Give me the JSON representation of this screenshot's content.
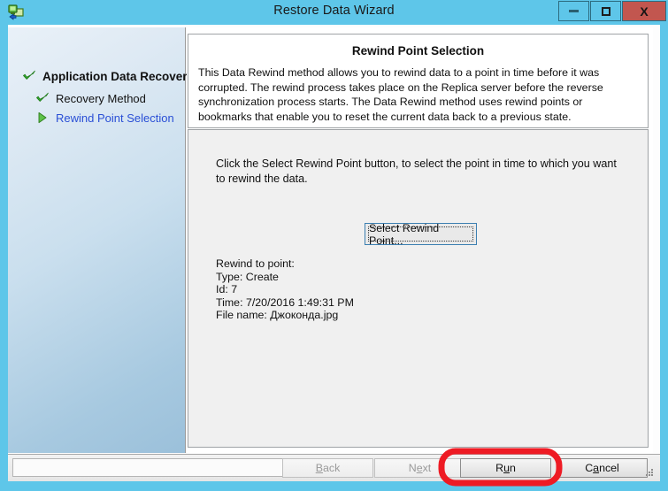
{
  "window": {
    "title": "Restore Data Wizard",
    "icon": "computer-restore-icon",
    "titlebar_color": "#5ec6e9",
    "close_button_color": "#c2564f",
    "controls": {
      "minimize_label": "–",
      "maximize_label": "□",
      "close_label": "X"
    }
  },
  "sidebar": {
    "items": [
      {
        "label": "Application Data Recovery",
        "icon": "green-check-icon",
        "state": "completed",
        "level": 0
      },
      {
        "label": "Recovery Method",
        "icon": "green-check-icon",
        "state": "completed",
        "level": 1
      },
      {
        "label": "Rewind Point Selection",
        "icon": "green-arrow-icon",
        "state": "current",
        "level": 1
      }
    ],
    "current_color": "#2a4fd6",
    "check_color": "#2faa2f"
  },
  "header": {
    "title": "Rewind Point Selection",
    "description": "This Data Rewind method allows you to rewind data to a point in time before it was corrupted. The rewind process takes place on the Replica server before the reverse synchronization process starts. The Data Rewind method uses rewind points or bookmarks that enable you to reset the current data back to a previous state."
  },
  "main": {
    "instructions": "Click the Select Rewind Point button, to select the point in time to which you want to rewind the data.",
    "select_button_label": "Select Rewind Point...",
    "details": {
      "heading": "Rewind to point:",
      "type": "Type: Create",
      "id": "Id: 7",
      "time": "Time: 7/20/2016 1:49:31 PM",
      "file_name": "File name: Джоконда.jpg"
    }
  },
  "footer": {
    "status_value": "",
    "status_placeholder": "",
    "buttons": [
      {
        "name": "back",
        "prefix": "",
        "accel": "B",
        "suffix": "ack",
        "enabled": false
      },
      {
        "name": "next",
        "prefix": "N",
        "accel": "e",
        "suffix": "xt",
        "enabled": false
      },
      {
        "name": "run",
        "prefix": "R",
        "accel": "u",
        "suffix": "n",
        "enabled": true
      },
      {
        "name": "cancel",
        "prefix": "C",
        "accel": "a",
        "suffix": "ncel",
        "enabled": true
      }
    ]
  },
  "annotation": {
    "shape": "rounded-rectangle",
    "color": "#ee1b24",
    "target": "run-button",
    "stroke_width": 6
  }
}
